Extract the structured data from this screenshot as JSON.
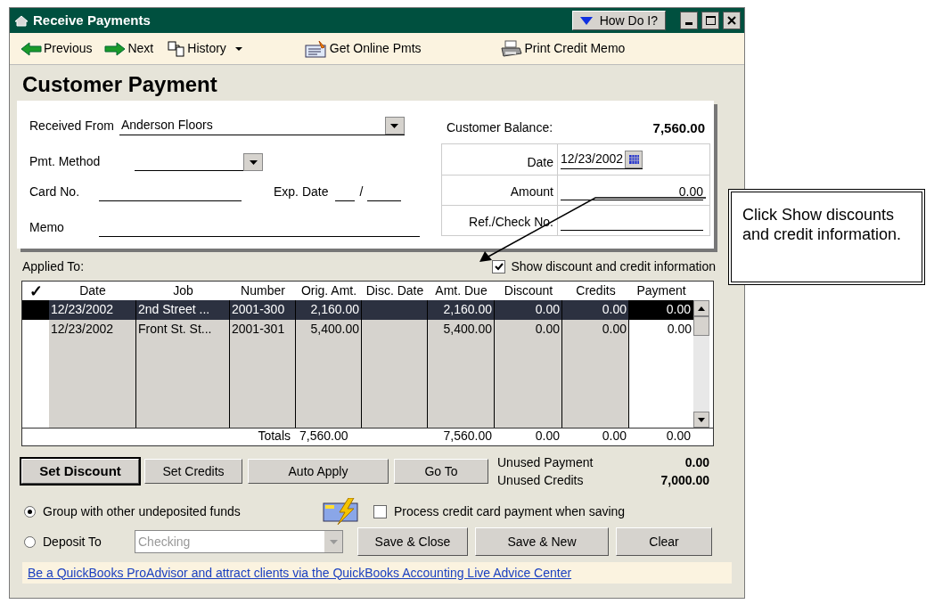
{
  "window": {
    "title": "Receive Payments",
    "help_button": "How Do I?"
  },
  "toolbar": [
    {
      "kind": "prev",
      "label": "Previous"
    },
    {
      "kind": "next",
      "label": "Next"
    },
    {
      "kind": "history",
      "label": "History"
    },
    {
      "kind": "online",
      "label": "Get Online Pmts"
    },
    {
      "kind": "print",
      "label": "Print Credit Memo"
    }
  ],
  "heading": "Customer Payment",
  "form": {
    "received_from": {
      "label": "Received From",
      "value": "Anderson Floors"
    },
    "pmt_method": {
      "label": "Pmt. Method"
    },
    "card_no": {
      "label": "Card No."
    },
    "exp_date": {
      "label": "Exp. Date",
      "separator": "/"
    },
    "memo": {
      "label": "Memo"
    },
    "customer_balance": {
      "label": "Customer Balance:",
      "value": "7,560.00"
    },
    "date": {
      "label": "Date",
      "value": "12/23/2002"
    },
    "amount": {
      "label": "Amount",
      "value": "0.00"
    },
    "ref_check_no": {
      "label": "Ref./Check No."
    }
  },
  "applied_to": "Applied To:",
  "show_discount": {
    "label": "Show discount and credit information",
    "checked": true
  },
  "table": {
    "columns": [
      "✓",
      "Date",
      "Job",
      "Number",
      "Orig. Amt.",
      "Disc. Date",
      "Amt. Due",
      "Discount",
      "Credits",
      "Payment"
    ],
    "rows": [
      {
        "selected": true,
        "cells": [
          "",
          "12/23/2002",
          "2nd Street ...",
          "2001-300",
          "2,160.00",
          "",
          "2,160.00",
          "0.00",
          "0.00",
          "0.00"
        ]
      },
      {
        "selected": false,
        "cells": [
          "",
          "12/23/2002",
          "Front St. St...",
          "2001-301",
          "5,400.00",
          "",
          "5,400.00",
          "0.00",
          "0.00",
          "0.00"
        ]
      }
    ],
    "totals": {
      "label": "Totals",
      "orig_amt": "7,560.00",
      "amt_due": "7,560.00",
      "discount": "0.00",
      "credits": "0.00",
      "payment": "0.00"
    }
  },
  "action_buttons": [
    {
      "label": "Set Discount",
      "default": true
    },
    {
      "label": "Set Credits",
      "default": false
    },
    {
      "label": "Auto Apply",
      "default": false
    },
    {
      "label": "Go To",
      "default": false
    }
  ],
  "unused": [
    {
      "label": "Unused Payment",
      "value": "0.00"
    },
    {
      "label": "Unused Credits",
      "value": "7,000.00"
    }
  ],
  "deposit_options": [
    {
      "label": "Group with other undeposited funds",
      "selected": true
    },
    {
      "label": "Deposit To",
      "selected": false
    }
  ],
  "deposit_account": "Checking",
  "process_cc": {
    "label": "Process credit card payment when saving",
    "checked": false
  },
  "save_buttons": [
    "Save & Close",
    "Save & New",
    "Clear"
  ],
  "link": "Be a QuickBooks ProAdvisor and attract clients via the QuickBooks Accounting Live Advice Center",
  "callout": "Click Show discounts and credit information."
}
